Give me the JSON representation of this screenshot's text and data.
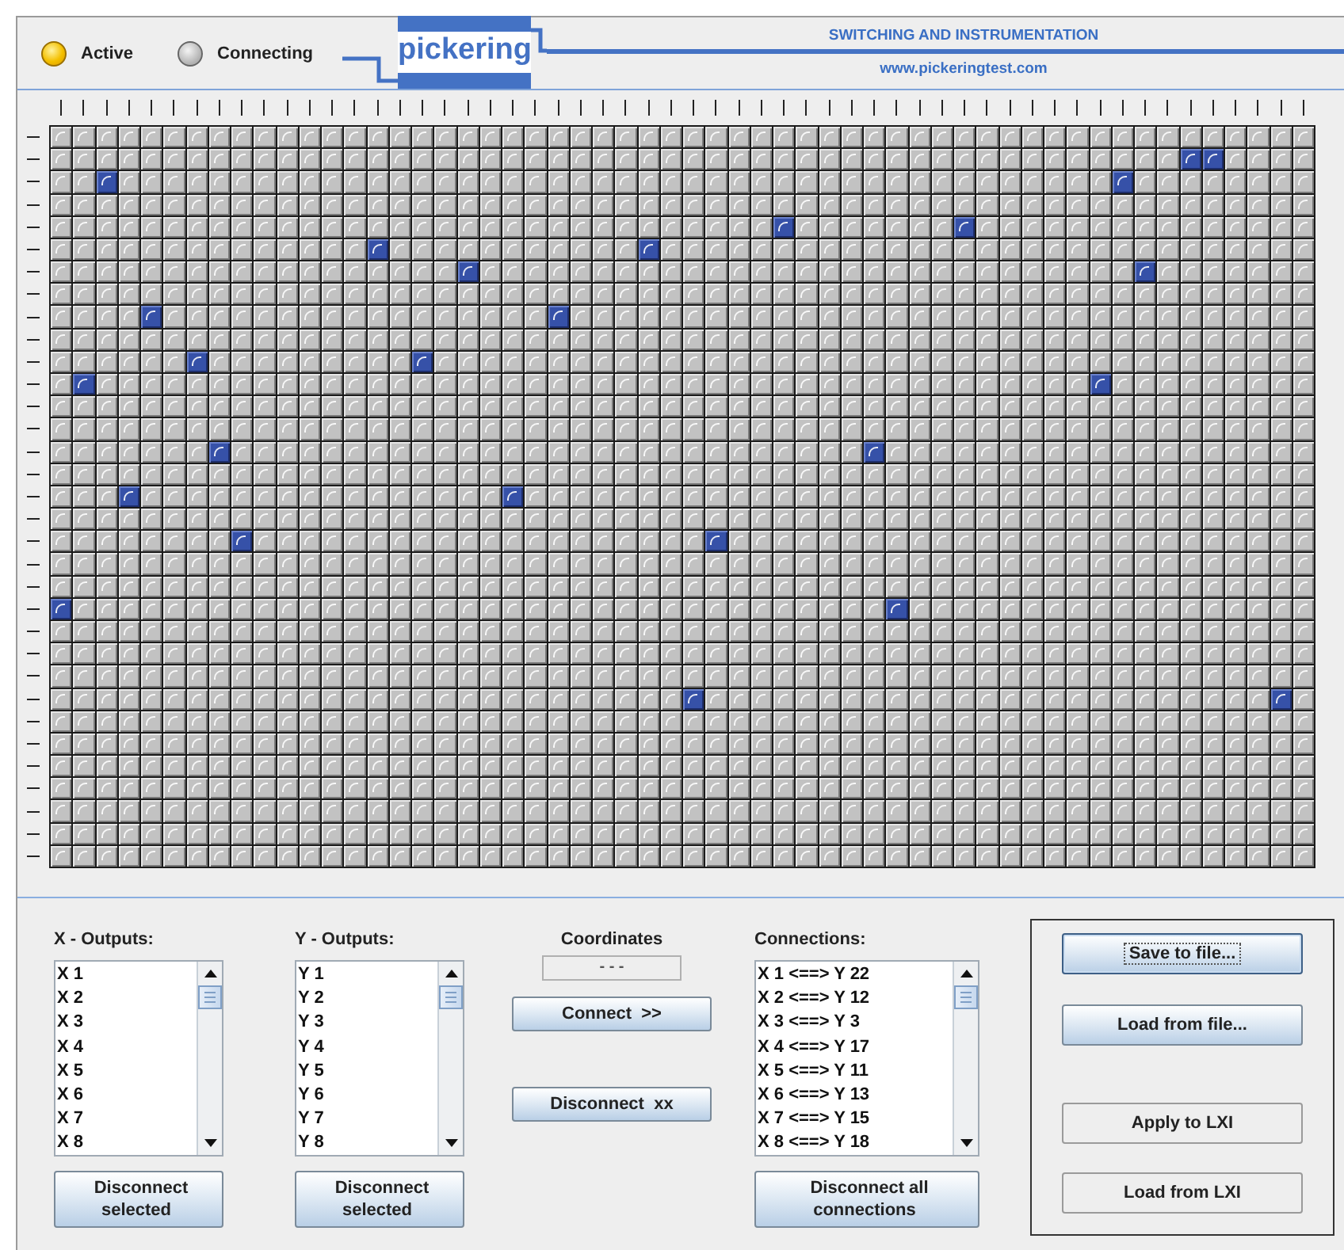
{
  "header": {
    "lamps": [
      {
        "label": "Active",
        "on": true
      },
      {
        "label": "Connecting",
        "on": false
      }
    ],
    "logo": "pickering",
    "tagline": "SWITCHING AND INSTRUMENTATION",
    "website": "www.pickeringtest.com"
  },
  "matrix": {
    "rows": [
      {
        "cells": [
          false,
          false,
          false,
          false,
          false,
          false,
          false,
          false,
          false,
          false,
          false,
          false,
          false,
          false,
          false,
          false,
          false,
          false,
          false,
          false,
          false,
          false,
          false,
          false,
          false,
          false,
          false,
          false,
          false,
          false,
          false,
          false,
          false,
          false,
          false,
          false,
          false,
          false,
          false,
          false,
          false,
          false,
          false,
          false,
          false,
          false,
          false,
          false,
          false,
          false,
          false,
          false,
          false,
          false,
          false,
          false
        ]
      },
      {
        "cells": [
          false,
          false,
          false,
          false,
          false,
          false,
          false,
          false,
          false,
          false,
          false,
          false,
          false,
          false,
          false,
          false,
          false,
          false,
          false,
          false,
          false,
          false,
          false,
          false,
          false,
          false,
          false,
          false,
          false,
          false,
          false,
          false,
          false,
          false,
          false,
          false,
          false,
          false,
          false,
          false,
          false,
          false,
          false,
          false,
          false,
          false,
          false,
          false,
          false,
          false,
          true,
          true,
          false,
          false,
          false,
          false
        ]
      },
      {
        "cells": [
          false,
          false,
          true,
          false,
          false,
          false,
          false,
          false,
          false,
          false,
          false,
          false,
          false,
          false,
          false,
          false,
          false,
          false,
          false,
          false,
          false,
          false,
          false,
          false,
          false,
          false,
          false,
          false,
          false,
          false,
          false,
          false,
          false,
          false,
          false,
          false,
          false,
          false,
          false,
          false,
          false,
          false,
          false,
          false,
          false,
          false,
          false,
          true,
          false,
          false,
          false,
          false,
          false,
          false,
          false,
          false
        ]
      },
      {
        "cells": [
          false,
          false,
          false,
          false,
          false,
          false,
          false,
          false,
          false,
          false,
          false,
          false,
          false,
          false,
          false,
          false,
          false,
          false,
          false,
          false,
          false,
          false,
          false,
          false,
          false,
          false,
          false,
          false,
          false,
          false,
          false,
          false,
          false,
          false,
          false,
          false,
          false,
          false,
          false,
          false,
          false,
          false,
          false,
          false,
          false,
          false,
          false,
          false,
          false,
          false,
          false,
          false,
          false,
          false,
          false,
          false
        ]
      },
      {
        "cells": [
          false,
          false,
          false,
          false,
          false,
          false,
          false,
          false,
          false,
          false,
          false,
          false,
          false,
          false,
          false,
          false,
          false,
          false,
          false,
          false,
          false,
          false,
          false,
          false,
          false,
          false,
          false,
          false,
          false,
          false,
          false,
          false,
          true,
          false,
          false,
          false,
          false,
          false,
          false,
          false,
          true,
          false,
          false,
          false,
          false,
          false,
          false,
          false,
          false,
          false,
          false,
          false,
          false,
          false,
          false,
          false
        ]
      },
      {
        "cells": [
          false,
          false,
          false,
          false,
          false,
          false,
          false,
          false,
          false,
          false,
          false,
          false,
          false,
          false,
          true,
          false,
          false,
          false,
          false,
          false,
          false,
          false,
          false,
          false,
          false,
          false,
          true,
          false,
          false,
          false,
          false,
          false,
          false,
          false,
          false,
          false,
          false,
          false,
          false,
          false,
          false,
          false,
          false,
          false,
          false,
          false,
          false,
          false,
          false,
          false,
          false,
          false,
          false,
          false,
          false,
          false
        ]
      },
      {
        "cells": [
          false,
          false,
          false,
          false,
          false,
          false,
          false,
          false,
          false,
          false,
          false,
          false,
          false,
          false,
          false,
          false,
          false,
          false,
          true,
          false,
          false,
          false,
          false,
          false,
          false,
          false,
          false,
          false,
          false,
          false,
          false,
          false,
          false,
          false,
          false,
          false,
          false,
          false,
          false,
          false,
          false,
          false,
          false,
          false,
          false,
          false,
          false,
          false,
          true,
          false,
          false,
          false,
          false,
          false,
          false,
          false
        ]
      },
      {
        "cells": [
          false,
          false,
          false,
          false,
          false,
          false,
          false,
          false,
          false,
          false,
          false,
          false,
          false,
          false,
          false,
          false,
          false,
          false,
          false,
          false,
          false,
          false,
          false,
          false,
          false,
          false,
          false,
          false,
          false,
          false,
          false,
          false,
          false,
          false,
          false,
          false,
          false,
          false,
          false,
          false,
          false,
          false,
          false,
          false,
          false,
          false,
          false,
          false,
          false,
          false,
          false,
          false,
          false,
          false,
          false,
          false
        ]
      },
      {
        "cells": [
          false,
          false,
          false,
          false,
          true,
          false,
          false,
          false,
          false,
          false,
          false,
          false,
          false,
          false,
          false,
          false,
          false,
          false,
          false,
          false,
          false,
          false,
          true,
          false,
          false,
          false,
          false,
          false,
          false,
          false,
          false,
          false,
          false,
          false,
          false,
          false,
          false,
          false,
          false,
          false,
          false,
          false,
          false,
          false,
          false,
          false,
          false,
          false,
          false,
          false,
          false,
          false,
          false,
          false,
          false,
          false
        ]
      },
      {
        "cells": [
          false,
          false,
          false,
          false,
          false,
          false,
          false,
          false,
          false,
          false,
          false,
          false,
          false,
          false,
          false,
          false,
          false,
          false,
          false,
          false,
          false,
          false,
          false,
          false,
          false,
          false,
          false,
          false,
          false,
          false,
          false,
          false,
          false,
          false,
          false,
          false,
          false,
          false,
          false,
          false,
          false,
          false,
          false,
          false,
          false,
          false,
          false,
          false,
          false,
          false,
          false,
          false,
          false,
          false,
          false,
          false
        ]
      },
      {
        "cells": [
          false,
          false,
          false,
          false,
          false,
          false,
          true,
          false,
          false,
          false,
          false,
          false,
          false,
          false,
          false,
          false,
          true,
          false,
          false,
          false,
          false,
          false,
          false,
          false,
          false,
          false,
          false,
          false,
          false,
          false,
          false,
          false,
          false,
          false,
          false,
          false,
          false,
          false,
          false,
          false,
          false,
          false,
          false,
          false,
          false,
          false,
          false,
          false,
          false,
          false,
          false,
          false,
          false,
          false,
          false,
          false
        ]
      },
      {
        "cells": [
          false,
          true,
          false,
          false,
          false,
          false,
          false,
          false,
          false,
          false,
          false,
          false,
          false,
          false,
          false,
          false,
          false,
          false,
          false,
          false,
          false,
          false,
          false,
          false,
          false,
          false,
          false,
          false,
          false,
          false,
          false,
          false,
          false,
          false,
          false,
          false,
          false,
          false,
          false,
          false,
          false,
          false,
          false,
          false,
          false,
          false,
          true,
          false,
          false,
          false,
          false,
          false,
          false,
          false,
          false,
          false
        ]
      },
      {
        "cells": [
          false,
          false,
          false,
          false,
          false,
          false,
          false,
          false,
          false,
          false,
          false,
          false,
          false,
          false,
          false,
          false,
          false,
          false,
          false,
          false,
          false,
          false,
          false,
          false,
          false,
          false,
          false,
          false,
          false,
          false,
          false,
          false,
          false,
          false,
          false,
          false,
          false,
          false,
          false,
          false,
          false,
          false,
          false,
          false,
          false,
          false,
          false,
          false,
          false,
          false,
          false,
          false,
          false,
          false,
          false,
          false
        ]
      },
      {
        "cells": [
          false,
          false,
          false,
          false,
          false,
          false,
          false,
          false,
          false,
          false,
          false,
          false,
          false,
          false,
          false,
          false,
          false,
          false,
          false,
          false,
          false,
          false,
          false,
          false,
          false,
          false,
          false,
          false,
          false,
          false,
          false,
          false,
          false,
          false,
          false,
          false,
          false,
          false,
          false,
          false,
          false,
          false,
          false,
          false,
          false,
          false,
          false,
          false,
          false,
          false,
          false,
          false,
          false,
          false,
          false,
          false
        ]
      },
      {
        "cells": [
          false,
          false,
          false,
          false,
          false,
          false,
          false,
          true,
          false,
          false,
          false,
          false,
          false,
          false,
          false,
          false,
          false,
          false,
          false,
          false,
          false,
          false,
          false,
          false,
          false,
          false,
          false,
          false,
          false,
          false,
          false,
          false,
          false,
          false,
          false,
          false,
          true,
          false,
          false,
          false,
          false,
          false,
          false,
          false,
          false,
          false,
          false,
          false,
          false,
          false,
          false,
          false,
          false,
          false,
          false,
          false
        ]
      },
      {
        "cells": [
          false,
          false,
          false,
          false,
          false,
          false,
          false,
          false,
          false,
          false,
          false,
          false,
          false,
          false,
          false,
          false,
          false,
          false,
          false,
          false,
          false,
          false,
          false,
          false,
          false,
          false,
          false,
          false,
          false,
          false,
          false,
          false,
          false,
          false,
          false,
          false,
          false,
          false,
          false,
          false,
          false,
          false,
          false,
          false,
          false,
          false,
          false,
          false,
          false,
          false,
          false,
          false,
          false,
          false,
          false,
          false
        ]
      },
      {
        "cells": [
          false,
          false,
          false,
          true,
          false,
          false,
          false,
          false,
          false,
          false,
          false,
          false,
          false,
          false,
          false,
          false,
          false,
          false,
          false,
          false,
          true,
          false,
          false,
          false,
          false,
          false,
          false,
          false,
          false,
          false,
          false,
          false,
          false,
          false,
          false,
          false,
          false,
          false,
          false,
          false,
          false,
          false,
          false,
          false,
          false,
          false,
          false,
          false,
          false,
          false,
          false,
          false,
          false,
          false,
          false,
          false
        ]
      },
      {
        "cells": [
          false,
          false,
          false,
          false,
          false,
          false,
          false,
          false,
          false,
          false,
          false,
          false,
          false,
          false,
          false,
          false,
          false,
          false,
          false,
          false,
          false,
          false,
          false,
          false,
          false,
          false,
          false,
          false,
          false,
          false,
          false,
          false,
          false,
          false,
          false,
          false,
          false,
          false,
          false,
          false,
          false,
          false,
          false,
          false,
          false,
          false,
          false,
          false,
          false,
          false,
          false,
          false,
          false,
          false,
          false,
          false
        ]
      },
      {
        "cells": [
          false,
          false,
          false,
          false,
          false,
          false,
          false,
          false,
          true,
          false,
          false,
          false,
          false,
          false,
          false,
          false,
          false,
          false,
          false,
          false,
          false,
          false,
          false,
          false,
          false,
          false,
          false,
          false,
          false,
          true,
          false,
          false,
          false,
          false,
          false,
          false,
          false,
          false,
          false,
          false,
          false,
          false,
          false,
          false,
          false,
          false,
          false,
          false,
          false,
          false,
          false,
          false,
          false,
          false,
          false,
          false
        ]
      },
      {
        "cells": [
          false,
          false,
          false,
          false,
          false,
          false,
          false,
          false,
          false,
          false,
          false,
          false,
          false,
          false,
          false,
          false,
          false,
          false,
          false,
          false,
          false,
          false,
          false,
          false,
          false,
          false,
          false,
          false,
          false,
          false,
          false,
          false,
          false,
          false,
          false,
          false,
          false,
          false,
          false,
          false,
          false,
          false,
          false,
          false,
          false,
          false,
          false,
          false,
          false,
          false,
          false,
          false,
          false,
          false,
          false,
          false
        ]
      },
      {
        "cells": [
          false,
          false,
          false,
          false,
          false,
          false,
          false,
          false,
          false,
          false,
          false,
          false,
          false,
          false,
          false,
          false,
          false,
          false,
          false,
          false,
          false,
          false,
          false,
          false,
          false,
          false,
          false,
          false,
          false,
          false,
          false,
          false,
          false,
          false,
          false,
          false,
          false,
          false,
          false,
          false,
          false,
          false,
          false,
          false,
          false,
          false,
          false,
          false,
          false,
          false,
          false,
          false,
          false,
          false,
          false,
          false
        ]
      },
      {
        "cells": [
          true,
          false,
          false,
          false,
          false,
          false,
          false,
          false,
          false,
          false,
          false,
          false,
          false,
          false,
          false,
          false,
          false,
          false,
          false,
          false,
          false,
          false,
          false,
          false,
          false,
          false,
          false,
          false,
          false,
          false,
          false,
          false,
          false,
          false,
          false,
          false,
          false,
          true,
          false,
          false,
          false,
          false,
          false,
          false,
          false,
          false,
          false,
          false,
          false,
          false,
          false,
          false,
          false,
          false,
          false,
          false
        ]
      },
      {
        "cells": [
          false,
          false,
          false,
          false,
          false,
          false,
          false,
          false,
          false,
          false,
          false,
          false,
          false,
          false,
          false,
          false,
          false,
          false,
          false,
          false,
          false,
          false,
          false,
          false,
          false,
          false,
          false,
          false,
          false,
          false,
          false,
          false,
          false,
          false,
          false,
          false,
          false,
          false,
          false,
          false,
          false,
          false,
          false,
          false,
          false,
          false,
          false,
          false,
          false,
          false,
          false,
          false,
          false,
          false,
          false,
          false
        ]
      },
      {
        "cells": [
          false,
          false,
          false,
          false,
          false,
          false,
          false,
          false,
          false,
          false,
          false,
          false,
          false,
          false,
          false,
          false,
          false,
          false,
          false,
          false,
          false,
          false,
          false,
          false,
          false,
          false,
          false,
          false,
          false,
          false,
          false,
          false,
          false,
          false,
          false,
          false,
          false,
          false,
          false,
          false,
          false,
          false,
          false,
          false,
          false,
          false,
          false,
          false,
          false,
          false,
          false,
          false,
          false,
          false,
          false,
          false
        ]
      },
      {
        "cells": [
          false,
          false,
          false,
          false,
          false,
          false,
          false,
          false,
          false,
          false,
          false,
          false,
          false,
          false,
          false,
          false,
          false,
          false,
          false,
          false,
          false,
          false,
          false,
          false,
          false,
          false,
          false,
          false,
          false,
          false,
          false,
          false,
          false,
          false,
          false,
          false,
          false,
          false,
          false,
          false,
          false,
          false,
          false,
          false,
          false,
          false,
          false,
          false,
          false,
          false,
          false,
          false,
          false,
          false,
          false,
          false
        ]
      },
      {
        "cells": [
          false,
          false,
          false,
          false,
          false,
          false,
          false,
          false,
          false,
          false,
          false,
          false,
          false,
          false,
          false,
          false,
          false,
          false,
          false,
          false,
          false,
          false,
          false,
          false,
          false,
          false,
          false,
          false,
          true,
          false,
          false,
          false,
          false,
          false,
          false,
          false,
          false,
          false,
          false,
          false,
          false,
          false,
          false,
          false,
          false,
          false,
          false,
          false,
          false,
          false,
          false,
          false,
          false,
          false,
          true,
          false
        ]
      },
      {
        "cells": [
          false,
          false,
          false,
          false,
          false,
          false,
          false,
          false,
          false,
          false,
          false,
          false,
          false,
          false,
          false,
          false,
          false,
          false,
          false,
          false,
          false,
          false,
          false,
          false,
          false,
          false,
          false,
          false,
          false,
          false,
          false,
          false,
          false,
          false,
          false,
          false,
          false,
          false,
          false,
          false,
          false,
          false,
          false,
          false,
          false,
          false,
          false,
          false,
          false,
          false,
          false,
          false,
          false,
          false,
          false,
          false
        ]
      },
      {
        "cells": [
          false,
          false,
          false,
          false,
          false,
          false,
          false,
          false,
          false,
          false,
          false,
          false,
          false,
          false,
          false,
          false,
          false,
          false,
          false,
          false,
          false,
          false,
          false,
          false,
          false,
          false,
          false,
          false,
          false,
          false,
          false,
          false,
          false,
          false,
          false,
          false,
          false,
          false,
          false,
          false,
          false,
          false,
          false,
          false,
          false,
          false,
          false,
          false,
          false,
          false,
          false,
          false,
          false,
          false,
          false,
          false
        ]
      },
      {
        "cells": [
          false,
          false,
          false,
          false,
          false,
          false,
          false,
          false,
          false,
          false,
          false,
          false,
          false,
          false,
          false,
          false,
          false,
          false,
          false,
          false,
          false,
          false,
          false,
          false,
          false,
          false,
          false,
          false,
          false,
          false,
          false,
          false,
          false,
          false,
          false,
          false,
          false,
          false,
          false,
          false,
          false,
          false,
          false,
          false,
          false,
          false,
          false,
          false,
          false,
          false,
          false,
          false,
          false,
          false,
          false,
          false
        ]
      },
      {
        "cells": [
          false,
          false,
          false,
          false,
          false,
          false,
          false,
          false,
          false,
          false,
          false,
          false,
          false,
          false,
          false,
          false,
          false,
          false,
          false,
          false,
          false,
          false,
          false,
          false,
          false,
          false,
          false,
          false,
          false,
          false,
          false,
          false,
          false,
          false,
          false,
          false,
          false,
          false,
          false,
          false,
          false,
          false,
          false,
          false,
          false,
          false,
          false,
          false,
          false,
          false,
          false,
          false,
          false,
          false,
          false,
          false
        ]
      },
      {
        "cells": [
          false,
          false,
          false,
          false,
          false,
          false,
          false,
          false,
          false,
          false,
          false,
          false,
          false,
          false,
          false,
          false,
          false,
          false,
          false,
          false,
          false,
          false,
          false,
          false,
          false,
          false,
          false,
          false,
          false,
          false,
          false,
          false,
          false,
          false,
          false,
          false,
          false,
          false,
          false,
          false,
          false,
          false,
          false,
          false,
          false,
          false,
          false,
          false,
          false,
          false,
          false,
          false,
          false,
          false,
          false,
          false
        ]
      },
      {
        "cells": [
          false,
          false,
          false,
          false,
          false,
          false,
          false,
          false,
          false,
          false,
          false,
          false,
          false,
          false,
          false,
          false,
          false,
          false,
          false,
          false,
          false,
          false,
          false,
          false,
          false,
          false,
          false,
          false,
          false,
          false,
          false,
          false,
          false,
          false,
          false,
          false,
          false,
          false,
          false,
          false,
          false,
          false,
          false,
          false,
          false,
          false,
          false,
          false,
          false,
          false,
          false,
          false,
          false,
          false,
          false,
          false
        ]
      },
      {
        "cells": [
          false,
          false,
          false,
          false,
          false,
          false,
          false,
          false,
          false,
          false,
          false,
          false,
          false,
          false,
          false,
          false,
          false,
          false,
          false,
          false,
          false,
          false,
          false,
          false,
          false,
          false,
          false,
          false,
          false,
          false,
          false,
          false,
          false,
          false,
          false,
          false,
          false,
          false,
          false,
          false,
          false,
          false,
          false,
          false,
          false,
          false,
          false,
          false,
          false,
          false,
          false,
          false,
          false,
          false,
          false,
          false
        ]
      }
    ]
  },
  "x_outputs": {
    "label": "X - Outputs:",
    "items": [
      "X 1",
      "X 2",
      "X 3",
      "X 4",
      "X 5",
      "X 6",
      "X 7",
      "X 8"
    ],
    "button": "Disconnect selected"
  },
  "y_outputs": {
    "label": "Y - Outputs:",
    "items": [
      "Y 1",
      "Y 2",
      "Y 3",
      "Y 4",
      "Y 5",
      "Y 6",
      "Y 7",
      "Y 8"
    ],
    "button": "Disconnect selected"
  },
  "coordinates": {
    "label": "Coordinates",
    "value": "- - -",
    "buttons": [
      "Connect  >>",
      "Disconnect  xx"
    ]
  },
  "connections": {
    "label": "Connections:",
    "items": [
      "X 1 <==> Y 22",
      "X 2 <==> Y 12",
      "X 3 <==> Y 3",
      "X 4 <==> Y 17",
      "X 5 <==> Y 11",
      "X 6 <==> Y 13",
      "X 7 <==> Y 15",
      "X 8 <==> Y 18"
    ],
    "button": "Disconnect all connections"
  },
  "file_actions": [
    {
      "label": "Save to file...",
      "kind": "raised",
      "focused": true
    },
    {
      "label": "Load from file...",
      "kind": "raised",
      "focused": false
    },
    {
      "label": "Apply to LXI",
      "kind": "flat",
      "focused": false
    },
    {
      "label": "Load from LXI",
      "kind": "flat",
      "focused": false
    }
  ]
}
